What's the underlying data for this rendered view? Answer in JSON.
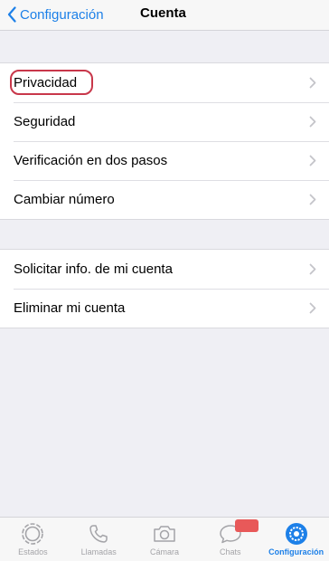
{
  "nav": {
    "back_label": "Configuración",
    "title": "Cuenta"
  },
  "group1": {
    "items": [
      {
        "label": "Privacidad"
      },
      {
        "label": "Seguridad"
      },
      {
        "label": "Verificación en dos pasos"
      },
      {
        "label": "Cambiar número"
      }
    ]
  },
  "group2": {
    "items": [
      {
        "label": "Solicitar info. de mi cuenta"
      },
      {
        "label": "Eliminar mi cuenta"
      }
    ]
  },
  "tabs": [
    {
      "label": "Estados",
      "icon": "status-icon",
      "active": false
    },
    {
      "label": "Llamadas",
      "icon": "phone-icon",
      "active": false
    },
    {
      "label": "Cámara",
      "icon": "camera-icon",
      "active": false
    },
    {
      "label": "Chats",
      "icon": "chat-bubble-icon",
      "active": false
    },
    {
      "label": "Configuración",
      "icon": "gear-icon",
      "active": true
    }
  ],
  "colors": {
    "accent": "#1d80e8",
    "highlight": "#c8374a",
    "badge": "#e85959"
  }
}
